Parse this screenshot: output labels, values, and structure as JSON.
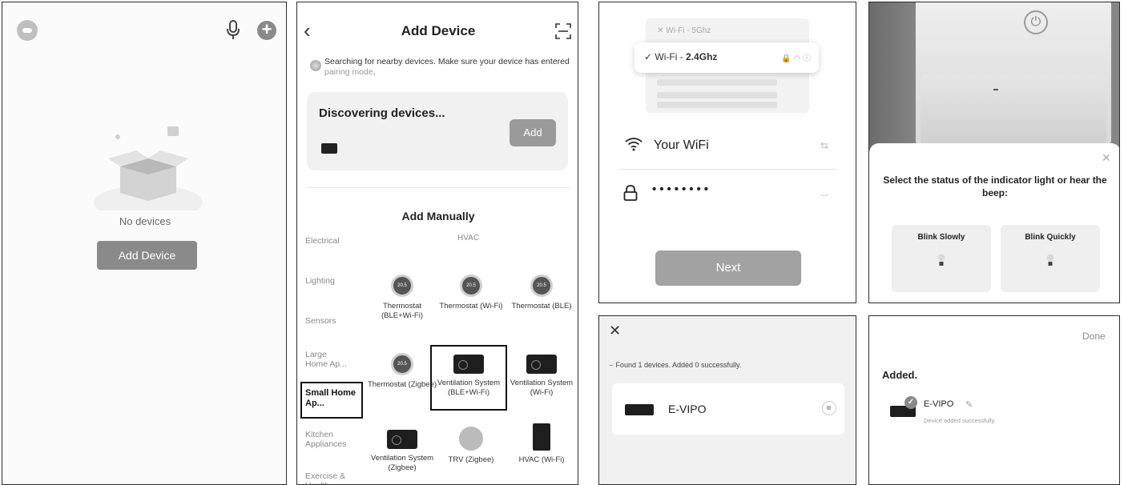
{
  "home": {
    "empty_text": "No devices",
    "add_device_label": "Add Device"
  },
  "add_device": {
    "title": "Add Device",
    "searching_text": "Searching for nearby devices. Make sure your device has entered",
    "pairing_link": "pairing mode",
    "searching_end": ".",
    "discovering_title": "Discovering devices...",
    "discovered_add_label": "Add",
    "add_manually_title": "Add Manually",
    "hvac_heading": "HVAC",
    "categories": [
      "Electrical",
      "Lighting",
      "Sensors",
      "Large Home Ap...",
      "Small Home Ap...",
      "Kitchen Appliances",
      "Exercise & Health"
    ],
    "tiles": [
      {
        "label": "Thermostat (BLE+Wi-Fi)",
        "icon": "thermostat-icon",
        "display": "20.5"
      },
      {
        "label": "Thermostat (Wi-Fi)",
        "icon": "thermostat-icon",
        "display": "20.5"
      },
      {
        "label": "Thermostat (BLE)",
        "icon": "thermostat-icon",
        "display": "20.5"
      },
      {
        "label": "Thermostat (Zigbee)",
        "icon": "thermostat-icon",
        "display": "20.5"
      },
      {
        "label": "Ventilation System (BLE+Wi-Fi)",
        "icon": "ventilation-icon"
      },
      {
        "label": "Ventilation System (Wi-Fi)",
        "icon": "ventilation-icon"
      },
      {
        "label": "Ventilation System (Zigbee)",
        "icon": "ventilation-icon"
      },
      {
        "label": "TRV (Zigbee)",
        "icon": "trv-icon"
      },
      {
        "label": "HVAC (Wi-Fi)",
        "icon": "hvac-icon"
      }
    ]
  },
  "wifi": {
    "option_5g": "Wi-Fi - 5Ghz",
    "option_24g_prefix": "Wi-Fi - ",
    "option_24g_band": "2.4Ghz",
    "ssid": "Your WiFi",
    "password_mask": "••••••••",
    "next_label": "Next"
  },
  "indicator": {
    "prompt": "Select the status of the indicator light or hear the beep:",
    "option_slow": "Blink Slowly",
    "option_quick": "Blink Quickly"
  },
  "found": {
    "status_text": "Found 1 devices. Added 0 successfully.",
    "device_name": "E-VIPO"
  },
  "done": {
    "done_label": "Done",
    "heading": "Added.",
    "device_name": "E-VIPO",
    "device_subtext": "Device added successfully"
  }
}
